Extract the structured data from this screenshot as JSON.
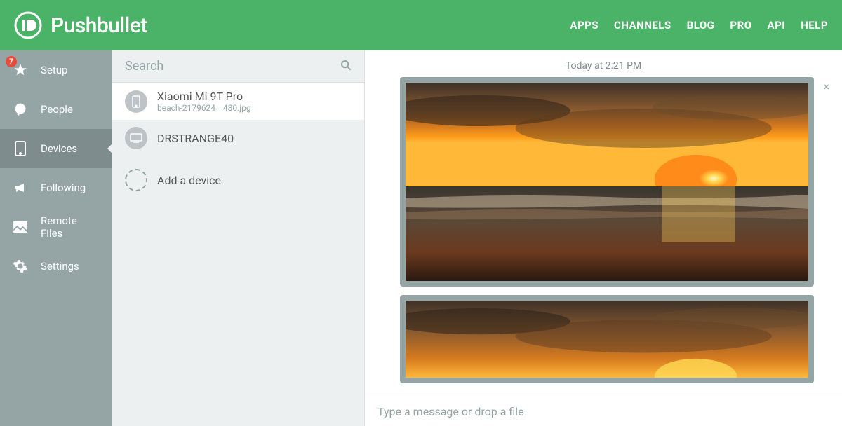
{
  "brand": "Pushbullet",
  "nav": {
    "apps": "APPS",
    "channels": "CHANNELS",
    "blog": "BLOG",
    "pro": "PRO",
    "api": "API",
    "help": "HELP"
  },
  "sidebar": {
    "badge": "7",
    "setup": "Setup",
    "people": "People",
    "devices": "Devices",
    "following": "Following",
    "remote": "Remote Files",
    "settings": "Settings"
  },
  "search": {
    "placeholder": "Search"
  },
  "devices": [
    {
      "name": "Xiaomi Mi 9T Pro",
      "sub": "beach-2179624__480.jpg"
    },
    {
      "name": "DRSTRANGE40",
      "sub": ""
    }
  ],
  "add_device": "Add a device",
  "timestamp": "Today at 2:21 PM",
  "compose": {
    "placeholder": "Type a message or drop a file"
  }
}
